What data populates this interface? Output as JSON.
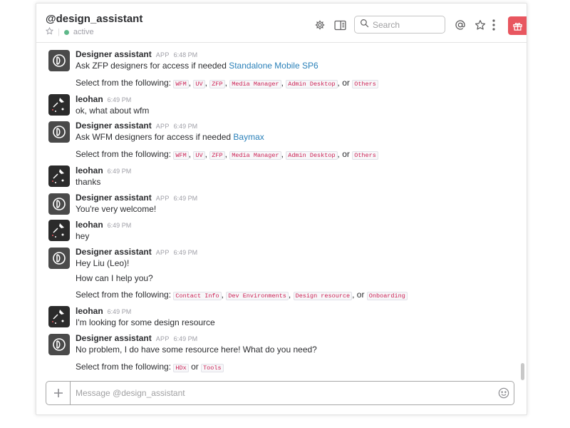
{
  "header": {
    "channel": "@design_assistant",
    "status": "active",
    "search_placeholder": "Search"
  },
  "messages": [
    {
      "sender": "Designer assistant",
      "app": "APP",
      "time": "6:48 PM",
      "text": "Ask ZFP designers for access if needed ",
      "link": "Standalone Mobile SP6"
    },
    {
      "select_prefix": "Select from the following:",
      "options": [
        "WFM",
        "UV",
        "ZFP",
        "Media Manager",
        "Admin Desktop"
      ],
      "or": "or",
      "last": "Others"
    },
    {
      "sender": "leohan",
      "time": "6:49 PM",
      "text": "ok, what about wfm"
    },
    {
      "sender": "Designer assistant",
      "app": "APP",
      "time": "6:49 PM",
      "text": "Ask WFM designers for access if needed ",
      "link": "Baymax"
    },
    {
      "select_prefix": "Select from the following:",
      "options": [
        "WFM",
        "UV",
        "ZFP",
        "Media Manager",
        "Admin Desktop"
      ],
      "or": "or",
      "last": "Others"
    },
    {
      "sender": "leohan",
      "time": "6:49 PM",
      "text": "thanks"
    },
    {
      "sender": "Designer assistant",
      "app": "APP",
      "time": "6:49 PM",
      "text": "You're very welcome!"
    },
    {
      "sender": "leohan",
      "time": "6:49 PM",
      "text": "hey"
    },
    {
      "sender": "Designer assistant",
      "app": "APP",
      "time": "6:49 PM",
      "text": "Hey Liu (Leo)!",
      "text2": "How can I help you?"
    },
    {
      "select_prefix": "Select from the following:",
      "options": [
        "Contact Info",
        "Dev Environments",
        "Design resource"
      ],
      "or": "or",
      "last": "Onboarding"
    },
    {
      "sender": "leohan",
      "time": "6:49 PM",
      "text": "I'm looking for some design resource"
    },
    {
      "sender": "Designer assistant",
      "app": "APP",
      "time": "6:49 PM",
      "text": "No problem, I do have some resource here! What do you need?"
    },
    {
      "select_prefix": "Select from the following:",
      "options": [],
      "first": "HDx",
      "or": "or",
      "last": "Tools"
    }
  ],
  "composer": {
    "placeholder": "Message @design_assistant"
  },
  "colors": {
    "link": "#2a80b9",
    "code_text": "#cc2255",
    "gift_button": "#e8565f",
    "presence": "#5fb88a"
  },
  "icons": [
    "star-icon",
    "gear-icon",
    "sidebar-toggle-icon",
    "search-icon",
    "mention-icon",
    "star-outline-icon",
    "more-vertical-icon",
    "gift-icon",
    "plus-icon",
    "emoji-icon"
  ]
}
